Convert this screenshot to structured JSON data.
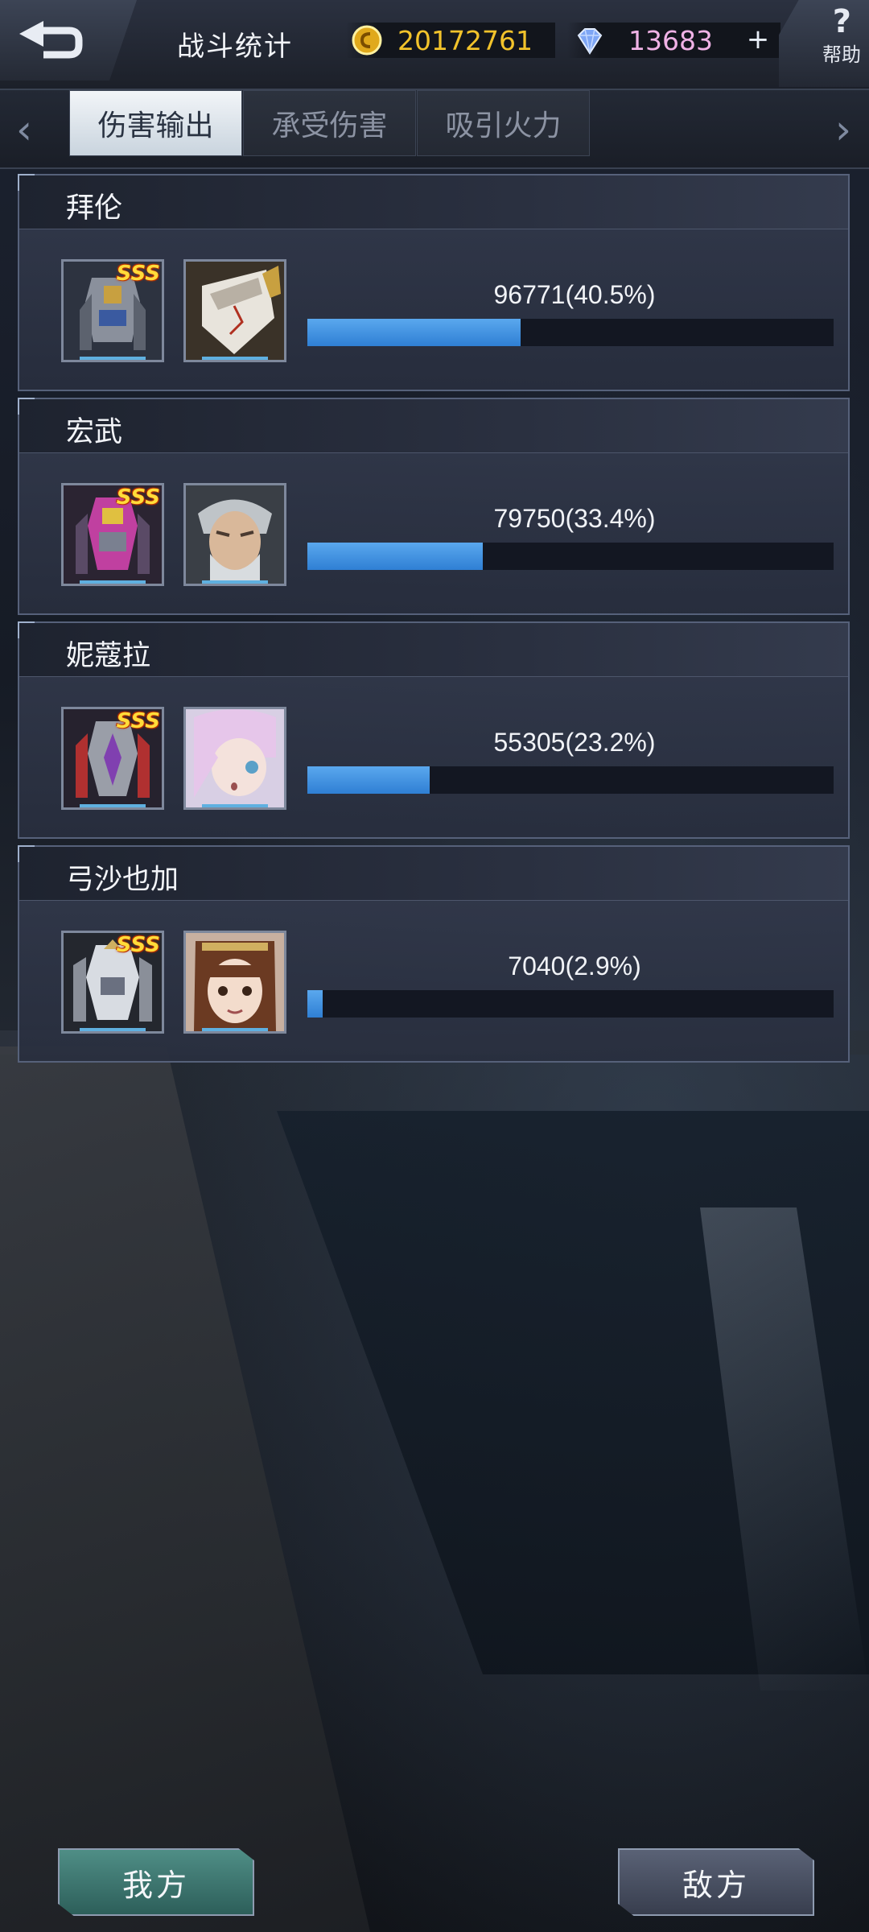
{
  "header": {
    "title": "战斗统计",
    "gold": "20172761",
    "gems": "13683",
    "plus": "+",
    "help_symbol": "?",
    "help_label": "帮助"
  },
  "tabs": [
    {
      "label": "伤害输出",
      "active": true
    },
    {
      "label": "承受伤害",
      "active": false
    },
    {
      "label": "吸引火力",
      "active": false
    }
  ],
  "nav": {
    "left_arrow": "‹",
    "right_arrow": "›"
  },
  "pilots": [
    {
      "name": "拜伦",
      "damage_text": "96771(40.5%)",
      "percent": 40.5,
      "rank": "SSS",
      "pilot_hair": "#e8e4dc",
      "accent": "#c8a040"
    },
    {
      "name": "宏武",
      "damage_text": "79750(33.4%)",
      "percent": 33.4,
      "rank": "SSS",
      "pilot_hair": "#bfc4c8",
      "accent": "#c040a0"
    },
    {
      "name": "妮蔻拉",
      "damage_text": "55305(23.2%)",
      "percent": 23.2,
      "rank": "SSS",
      "pilot_hair": "#e6c6ea",
      "accent": "#8040b0"
    },
    {
      "name": "弓沙也加",
      "damage_text": "7040(2.9%)",
      "percent": 2.9,
      "rank": "SSS",
      "pilot_hair": "#6b3a22",
      "accent": "#d0b060"
    }
  ],
  "footer": {
    "our_side": "我方",
    "enemy_side": "敌方"
  },
  "colors": {
    "gold_text": "#f2c32b",
    "gem_text": "#f0b2e6",
    "bar_fill": "#3f8fe0"
  }
}
